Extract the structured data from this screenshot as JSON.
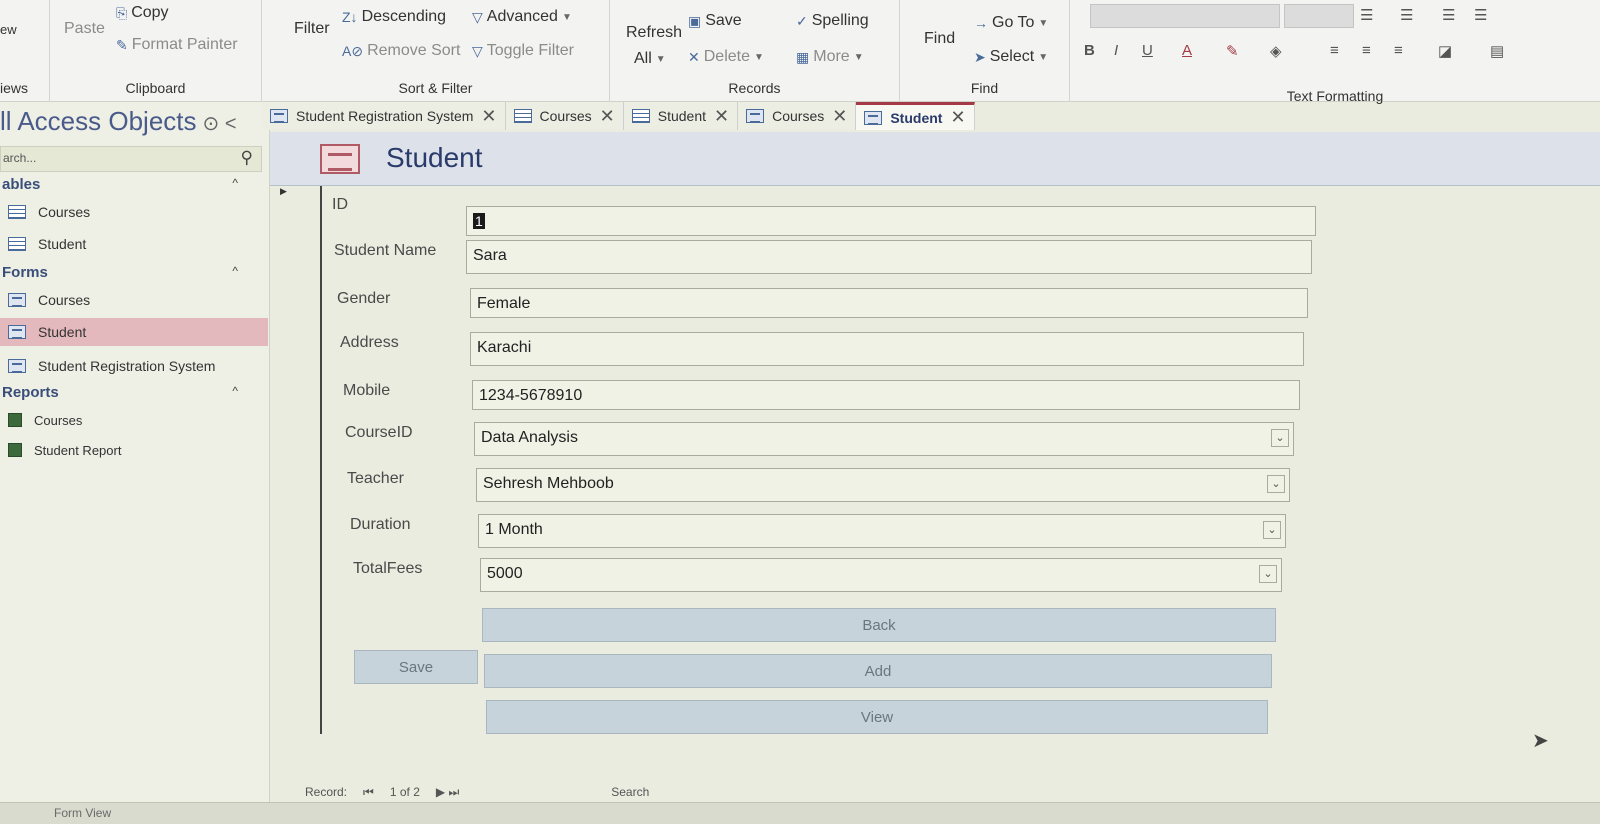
{
  "ribbon": {
    "views": {
      "label": "iews",
      "btn": "ew"
    },
    "clipboard": {
      "label": "Clipboard",
      "paste": "Paste",
      "copy": "Copy",
      "format_painter": "Format Painter"
    },
    "sort_filter": {
      "label": "Sort & Filter",
      "filter": "Filter",
      "descending": "Descending",
      "remove_sort": "Remove Sort",
      "advanced": "Advanced",
      "toggle_filter": "Toggle Filter"
    },
    "records": {
      "label": "Records",
      "refresh": "Refresh",
      "all": "All",
      "save": "Save",
      "delete": "Delete",
      "spelling": "Spelling",
      "more": "More"
    },
    "find": {
      "label": "Find",
      "find": "Find",
      "goto": "Go To",
      "select": "Select"
    },
    "text_formatting": {
      "label": "Text Formatting",
      "bold": "B",
      "italic": "I",
      "underline": "U",
      "font_color": "A"
    }
  },
  "navpane": {
    "title": "ll Access Objects",
    "search_placeholder": "arch...",
    "sections": {
      "tables": "ables",
      "forms": "Forms",
      "reports": "Reports"
    },
    "tables": [
      "Courses",
      "Student"
    ],
    "forms": [
      "Courses",
      "Student",
      "Student Registration System"
    ],
    "reports": [
      "Courses",
      "Student Report"
    ]
  },
  "tabs": [
    {
      "label": "Student Registration System",
      "active": false
    },
    {
      "label": "Courses",
      "active": false
    },
    {
      "label": "Student",
      "active": false
    },
    {
      "label": "Courses",
      "active": false
    },
    {
      "label": "Student",
      "active": true
    }
  ],
  "form": {
    "title": "Student",
    "fields": {
      "id": {
        "label": "ID",
        "value": "1"
      },
      "student_name": {
        "label": "Student Name",
        "value": "Sara"
      },
      "gender": {
        "label": "Gender",
        "value": "Female"
      },
      "address": {
        "label": "Address",
        "value": "Karachi"
      },
      "mobile": {
        "label": "Mobile",
        "value": "1234-5678910"
      },
      "course_id": {
        "label": "CourseID",
        "value": "Data Analysis"
      },
      "teacher": {
        "label": "Teacher",
        "value": "Sehresh Mehboob"
      },
      "duration": {
        "label": "Duration",
        "value": "1 Month"
      },
      "total_fees": {
        "label": "TotalFees",
        "value": "5000"
      }
    },
    "buttons": {
      "back": "Back",
      "save": "Save",
      "add": "Add",
      "view": "View"
    }
  },
  "record_nav": {
    "label": "Record:",
    "position": "1 of 2",
    "search": "Search"
  },
  "status_bar": {
    "text": "Form View"
  },
  "colors": {
    "accent": "#a33a46",
    "selected_nav": "#e4b9bd",
    "button": "#c7d3da"
  }
}
